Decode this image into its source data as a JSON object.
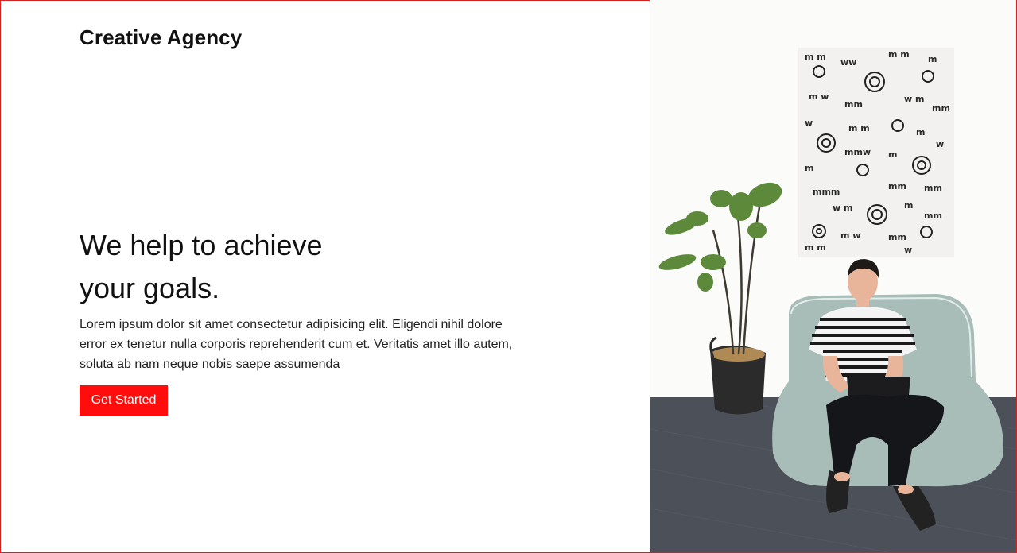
{
  "header": {
    "brand": "Creative Agency"
  },
  "hero": {
    "title_line1": "We help to achieve",
    "title_line2": "your goals.",
    "paragraph": "Lorem ipsum dolor sit amet consectetur adipisicing elit. Eligendi nihil dolore error ex tenetur nulla corporis reprehenderit cum et. Veritatis amet illo autem, soluta ab nam neque nobis saepe assumenda",
    "cta_label": "Get Started"
  },
  "colors": {
    "accent": "#ff0d0d",
    "frame": "#d32222",
    "text": "#111111"
  },
  "image": {
    "semantic": "person-on-beanbag-with-laptop-photo"
  }
}
